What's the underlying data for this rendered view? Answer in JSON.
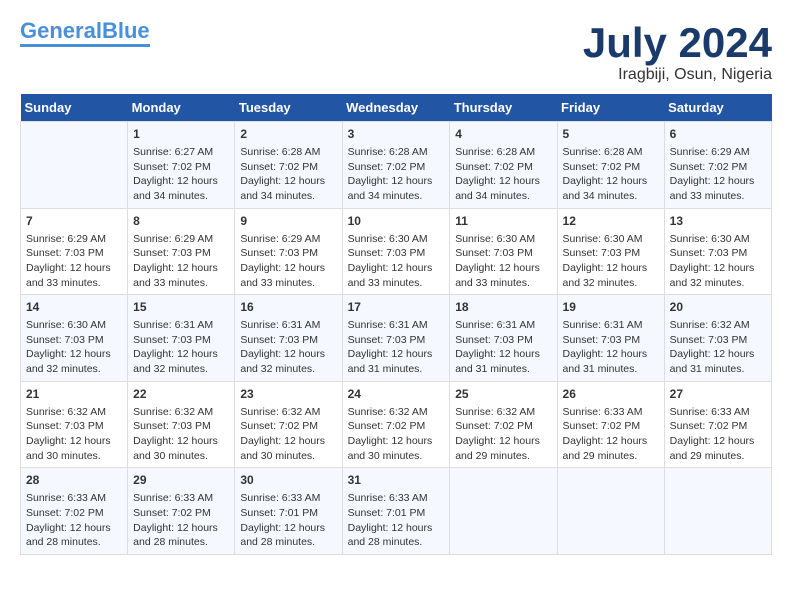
{
  "logo": {
    "part1": "General",
    "part2": "Blue"
  },
  "title": "July 2024",
  "location": "Iragbiji, Osun, Nigeria",
  "days_of_week": [
    "Sunday",
    "Monday",
    "Tuesday",
    "Wednesday",
    "Thursday",
    "Friday",
    "Saturday"
  ],
  "weeks": [
    [
      {
        "day": "",
        "sunrise": "",
        "sunset": "",
        "daylight": ""
      },
      {
        "day": "1",
        "sunrise": "Sunrise: 6:27 AM",
        "sunset": "Sunset: 7:02 PM",
        "daylight": "Daylight: 12 hours and 34 minutes."
      },
      {
        "day": "2",
        "sunrise": "Sunrise: 6:28 AM",
        "sunset": "Sunset: 7:02 PM",
        "daylight": "Daylight: 12 hours and 34 minutes."
      },
      {
        "day": "3",
        "sunrise": "Sunrise: 6:28 AM",
        "sunset": "Sunset: 7:02 PM",
        "daylight": "Daylight: 12 hours and 34 minutes."
      },
      {
        "day": "4",
        "sunrise": "Sunrise: 6:28 AM",
        "sunset": "Sunset: 7:02 PM",
        "daylight": "Daylight: 12 hours and 34 minutes."
      },
      {
        "day": "5",
        "sunrise": "Sunrise: 6:28 AM",
        "sunset": "Sunset: 7:02 PM",
        "daylight": "Daylight: 12 hours and 34 minutes."
      },
      {
        "day": "6",
        "sunrise": "Sunrise: 6:29 AM",
        "sunset": "Sunset: 7:02 PM",
        "daylight": "Daylight: 12 hours and 33 minutes."
      }
    ],
    [
      {
        "day": "7",
        "sunrise": "Sunrise: 6:29 AM",
        "sunset": "Sunset: 7:03 PM",
        "daylight": "Daylight: 12 hours and 33 minutes."
      },
      {
        "day": "8",
        "sunrise": "Sunrise: 6:29 AM",
        "sunset": "Sunset: 7:03 PM",
        "daylight": "Daylight: 12 hours and 33 minutes."
      },
      {
        "day": "9",
        "sunrise": "Sunrise: 6:29 AM",
        "sunset": "Sunset: 7:03 PM",
        "daylight": "Daylight: 12 hours and 33 minutes."
      },
      {
        "day": "10",
        "sunrise": "Sunrise: 6:30 AM",
        "sunset": "Sunset: 7:03 PM",
        "daylight": "Daylight: 12 hours and 33 minutes."
      },
      {
        "day": "11",
        "sunrise": "Sunrise: 6:30 AM",
        "sunset": "Sunset: 7:03 PM",
        "daylight": "Daylight: 12 hours and 33 minutes."
      },
      {
        "day": "12",
        "sunrise": "Sunrise: 6:30 AM",
        "sunset": "Sunset: 7:03 PM",
        "daylight": "Daylight: 12 hours and 32 minutes."
      },
      {
        "day": "13",
        "sunrise": "Sunrise: 6:30 AM",
        "sunset": "Sunset: 7:03 PM",
        "daylight": "Daylight: 12 hours and 32 minutes."
      }
    ],
    [
      {
        "day": "14",
        "sunrise": "Sunrise: 6:30 AM",
        "sunset": "Sunset: 7:03 PM",
        "daylight": "Daylight: 12 hours and 32 minutes."
      },
      {
        "day": "15",
        "sunrise": "Sunrise: 6:31 AM",
        "sunset": "Sunset: 7:03 PM",
        "daylight": "Daylight: 12 hours and 32 minutes."
      },
      {
        "day": "16",
        "sunrise": "Sunrise: 6:31 AM",
        "sunset": "Sunset: 7:03 PM",
        "daylight": "Daylight: 12 hours and 32 minutes."
      },
      {
        "day": "17",
        "sunrise": "Sunrise: 6:31 AM",
        "sunset": "Sunset: 7:03 PM",
        "daylight": "Daylight: 12 hours and 31 minutes."
      },
      {
        "day": "18",
        "sunrise": "Sunrise: 6:31 AM",
        "sunset": "Sunset: 7:03 PM",
        "daylight": "Daylight: 12 hours and 31 minutes."
      },
      {
        "day": "19",
        "sunrise": "Sunrise: 6:31 AM",
        "sunset": "Sunset: 7:03 PM",
        "daylight": "Daylight: 12 hours and 31 minutes."
      },
      {
        "day": "20",
        "sunrise": "Sunrise: 6:32 AM",
        "sunset": "Sunset: 7:03 PM",
        "daylight": "Daylight: 12 hours and 31 minutes."
      }
    ],
    [
      {
        "day": "21",
        "sunrise": "Sunrise: 6:32 AM",
        "sunset": "Sunset: 7:03 PM",
        "daylight": "Daylight: 12 hours and 30 minutes."
      },
      {
        "day": "22",
        "sunrise": "Sunrise: 6:32 AM",
        "sunset": "Sunset: 7:03 PM",
        "daylight": "Daylight: 12 hours and 30 minutes."
      },
      {
        "day": "23",
        "sunrise": "Sunrise: 6:32 AM",
        "sunset": "Sunset: 7:02 PM",
        "daylight": "Daylight: 12 hours and 30 minutes."
      },
      {
        "day": "24",
        "sunrise": "Sunrise: 6:32 AM",
        "sunset": "Sunset: 7:02 PM",
        "daylight": "Daylight: 12 hours and 30 minutes."
      },
      {
        "day": "25",
        "sunrise": "Sunrise: 6:32 AM",
        "sunset": "Sunset: 7:02 PM",
        "daylight": "Daylight: 12 hours and 29 minutes."
      },
      {
        "day": "26",
        "sunrise": "Sunrise: 6:33 AM",
        "sunset": "Sunset: 7:02 PM",
        "daylight": "Daylight: 12 hours and 29 minutes."
      },
      {
        "day": "27",
        "sunrise": "Sunrise: 6:33 AM",
        "sunset": "Sunset: 7:02 PM",
        "daylight": "Daylight: 12 hours and 29 minutes."
      }
    ],
    [
      {
        "day": "28",
        "sunrise": "Sunrise: 6:33 AM",
        "sunset": "Sunset: 7:02 PM",
        "daylight": "Daylight: 12 hours and 28 minutes."
      },
      {
        "day": "29",
        "sunrise": "Sunrise: 6:33 AM",
        "sunset": "Sunset: 7:02 PM",
        "daylight": "Daylight: 12 hours and 28 minutes."
      },
      {
        "day": "30",
        "sunrise": "Sunrise: 6:33 AM",
        "sunset": "Sunset: 7:01 PM",
        "daylight": "Daylight: 12 hours and 28 minutes."
      },
      {
        "day": "31",
        "sunrise": "Sunrise: 6:33 AM",
        "sunset": "Sunset: 7:01 PM",
        "daylight": "Daylight: 12 hours and 28 minutes."
      },
      {
        "day": "",
        "sunrise": "",
        "sunset": "",
        "daylight": ""
      },
      {
        "day": "",
        "sunrise": "",
        "sunset": "",
        "daylight": ""
      },
      {
        "day": "",
        "sunrise": "",
        "sunset": "",
        "daylight": ""
      }
    ]
  ]
}
